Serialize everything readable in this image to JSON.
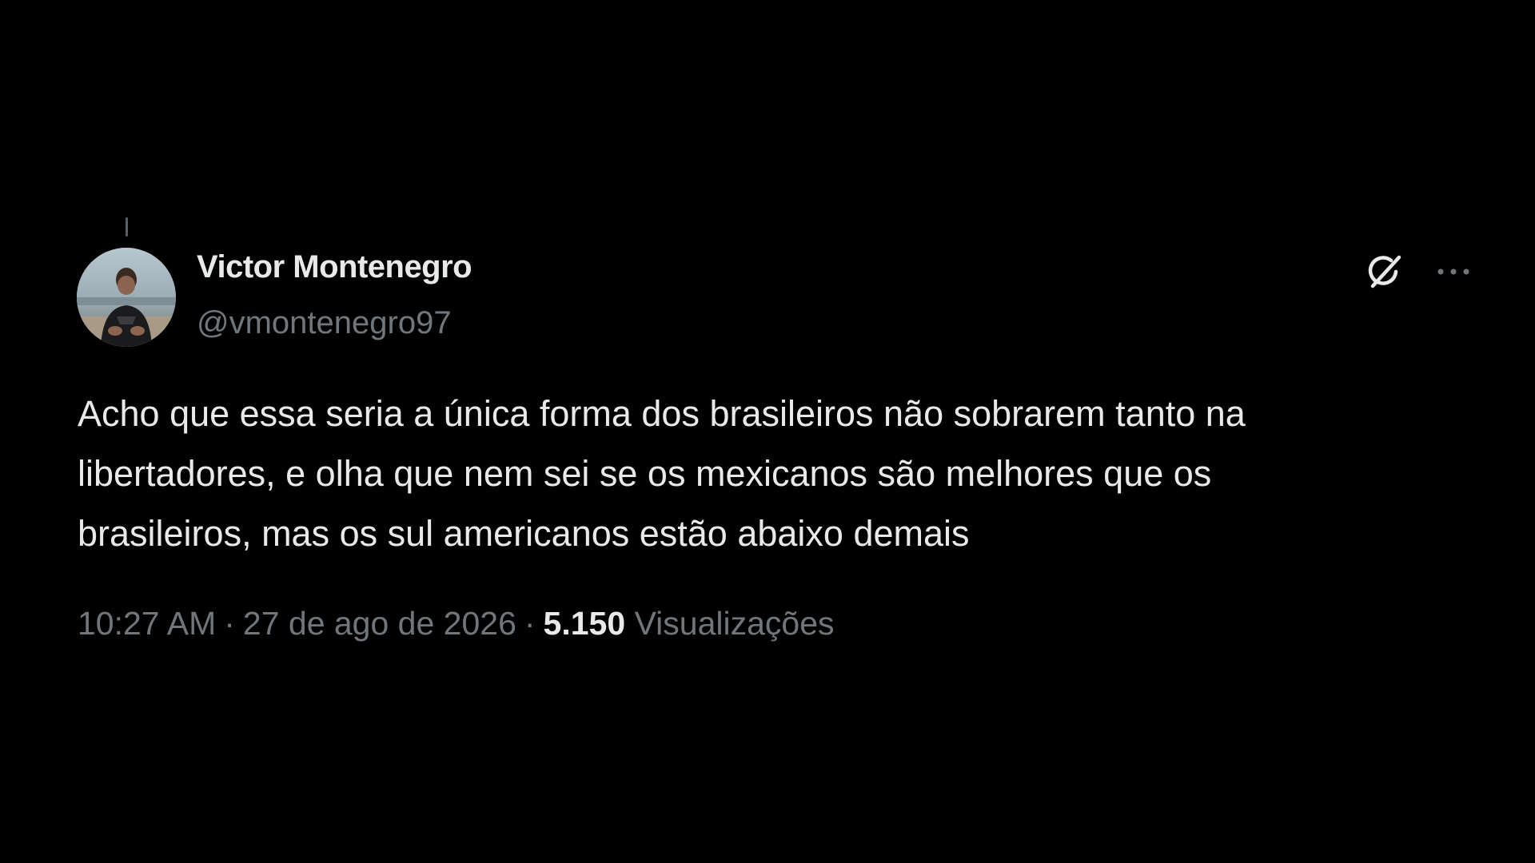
{
  "author": {
    "name": "Victor Montenegro",
    "handle": "@vmontenegro97"
  },
  "tweet": {
    "lines": [
      "Acho que essa seria a única forma dos brasileiros não sobrarem tanto na",
      "libertadores, e olha que nem sei se os mexicanos são melhores que os",
      "brasileiros, mas os sul americanos estão abaixo demais"
    ]
  },
  "meta": {
    "time": "10:27 AM",
    "separator": "·",
    "date": "27 de ago de 2026",
    "views_count": "5.150",
    "views_label": "Visualizações"
  },
  "icons": {
    "grok": "grok-icon",
    "more": "more-options-icon"
  },
  "colors": {
    "background": "#000000",
    "primary_text": "#e7e9ea",
    "secondary_text": "#71767b"
  }
}
